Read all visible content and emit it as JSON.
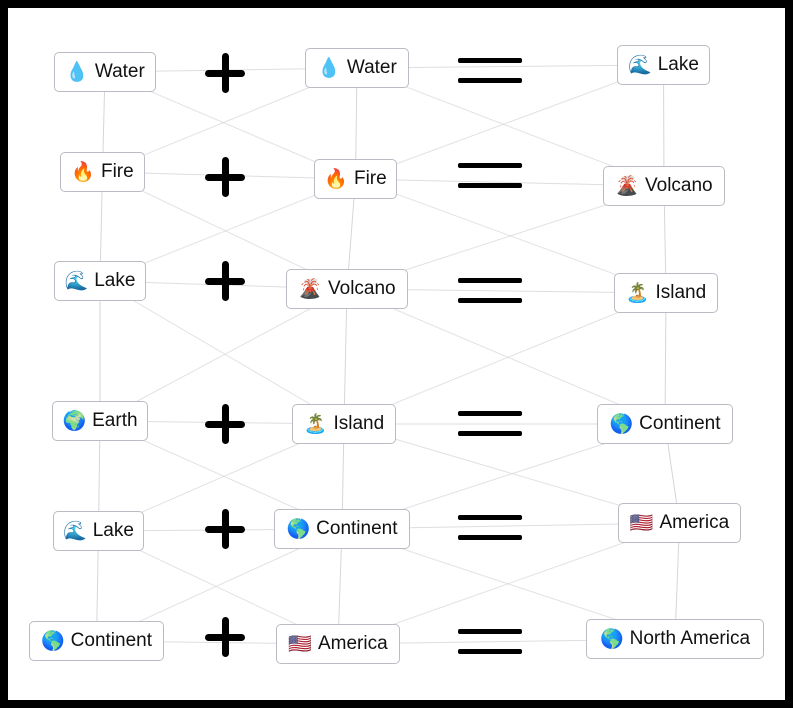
{
  "rows": [
    {
      "a": {
        "emoji": "💧",
        "label": "Water"
      },
      "b": {
        "emoji": "💧",
        "label": "Water"
      },
      "result": {
        "emoji": "🌊",
        "label": "Lake"
      }
    },
    {
      "a": {
        "emoji": "🔥",
        "label": "Fire"
      },
      "b": {
        "emoji": "🔥",
        "label": "Fire"
      },
      "result": {
        "emoji": "🌋",
        "label": "Volcano"
      }
    },
    {
      "a": {
        "emoji": "🌊",
        "label": "Lake"
      },
      "b": {
        "emoji": "🌋",
        "label": "Volcano"
      },
      "result": {
        "emoji": "🏝️",
        "label": "Island"
      }
    },
    {
      "a": {
        "emoji": "🌍",
        "label": "Earth"
      },
      "b": {
        "emoji": "🏝️",
        "label": "Island"
      },
      "result": {
        "emoji": "🌎",
        "label": "Continent"
      }
    },
    {
      "a": {
        "emoji": "🌊",
        "label": "Lake"
      },
      "b": {
        "emoji": "🌎",
        "label": "Continent"
      },
      "result": {
        "emoji": "🇺🇸",
        "label": "America"
      }
    },
    {
      "a": {
        "emoji": "🌎",
        "label": "Continent"
      },
      "b": {
        "emoji": "🇺🇸",
        "label": "America"
      },
      "result": {
        "emoji": "🌎",
        "label": "North America"
      }
    }
  ],
  "colors": {
    "border": "#000000",
    "card_border": "#b9bcc2",
    "line": "#d4d6da"
  }
}
